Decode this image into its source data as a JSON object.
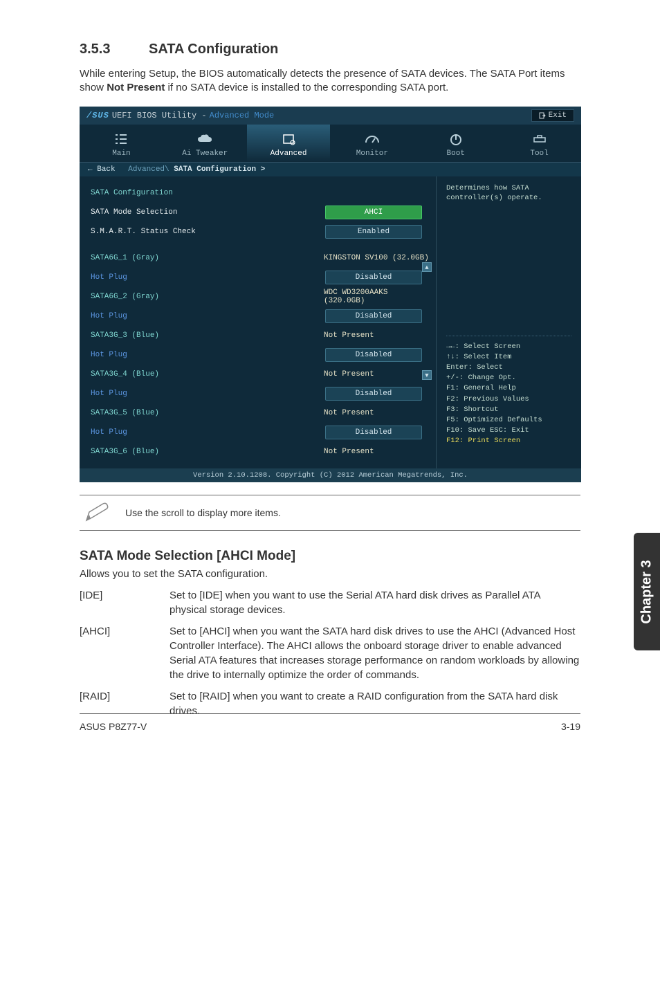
{
  "section": {
    "number": "3.5.3",
    "title": "SATA Configuration"
  },
  "intro_prefix": "While entering Setup, the BIOS automatically detects the presence of SATA devices. The SATA Port items show ",
  "intro_bold": "Not Present",
  "intro_suffix": " if no SATA device is installed to the corresponding SATA port.",
  "bios": {
    "logo_prefix": "/SUS",
    "title1": "UEFI BIOS Utility -",
    "title2": "Advanced Mode",
    "exit_label": "Exit",
    "tabs": [
      "Main",
      "Ai Tweaker",
      "Advanced",
      "Monitor",
      "Boot",
      "Tool"
    ],
    "back_label": "← Back",
    "breadcrumb_path": "Advanced\\",
    "breadcrumb_current": " SATA Configuration >",
    "panel_header": "SATA Configuration",
    "rows": [
      {
        "label": "SATA Mode Selection",
        "kind": "pill-green",
        "value": "AHCI",
        "cls": "sel"
      },
      {
        "label": "S.M.A.R.T. Status Check",
        "kind": "pill",
        "value": "Enabled",
        "cls": "sel"
      },
      {
        "label": "SATA6G_1 (Gray)",
        "kind": "text",
        "value": "KINGSTON SV100 (32.0GB)",
        "cls": "teal"
      },
      {
        "label": "Hot Plug",
        "kind": "pill",
        "value": "Disabled",
        "cls": "blue"
      },
      {
        "label": "SATA6G_2 (Gray)",
        "kind": "text",
        "value": "WDC WD3200AAKS (320.0GB)",
        "cls": "teal"
      },
      {
        "label": "Hot Plug",
        "kind": "pill",
        "value": "Disabled",
        "cls": "blue"
      },
      {
        "label": "SATA3G_3 (Blue)",
        "kind": "text",
        "value": "Not Present",
        "cls": "teal"
      },
      {
        "label": "Hot Plug",
        "kind": "pill",
        "value": "Disabled",
        "cls": "blue"
      },
      {
        "label": "SATA3G_4 (Blue)",
        "kind": "text",
        "value": "Not Present",
        "cls": "teal"
      },
      {
        "label": "Hot Plug",
        "kind": "pill",
        "value": "Disabled",
        "cls": "blue"
      },
      {
        "label": "SATA3G_5 (Blue)",
        "kind": "text",
        "value": "Not Present",
        "cls": "teal"
      },
      {
        "label": "Hot Plug",
        "kind": "pill",
        "value": "Disabled",
        "cls": "blue"
      },
      {
        "label": "SATA3G_6 (Blue)",
        "kind": "text",
        "value": "Not Present",
        "cls": "teal"
      }
    ],
    "help_text": "Determines how SATA controller(s) operate.",
    "hints": [
      "→←: Select Screen",
      "↑↓: Select Item",
      "Enter: Select",
      "+/-: Change Opt.",
      "F1: General Help",
      "F2: Previous Values",
      "F3: Shortcut",
      "F5: Optimized Defaults",
      "F10: Save  ESC: Exit",
      "F12: Print Screen"
    ],
    "footer": "Version 2.10.1208. Copyright (C) 2012 American Megatrends, Inc."
  },
  "note": "Use the scroll to display more items.",
  "sub": {
    "heading": "SATA Mode Selection [AHCI Mode]",
    "desc": "Allows you to set the SATA configuration."
  },
  "options": [
    {
      "key": "[IDE]",
      "desc": "Set to [IDE] when you want to use the Serial ATA hard disk drives as Parallel ATA physical storage devices."
    },
    {
      "key": "[AHCI]",
      "desc": "Set to [AHCI] when you want the SATA hard disk drives to use the AHCI (Advanced Host Controller Interface). The AHCI allows the onboard storage driver to enable advanced Serial ATA features that increases storage performance on random workloads by allowing the drive to internally optimize the order of commands."
    },
    {
      "key": "[RAID]",
      "desc": "Set to [RAID] when you want to create a RAID configuration from the SATA hard disk drives."
    }
  ],
  "chapter_tab": "Chapter 3",
  "footer_left": "ASUS P8Z77-V",
  "footer_right": "3-19"
}
